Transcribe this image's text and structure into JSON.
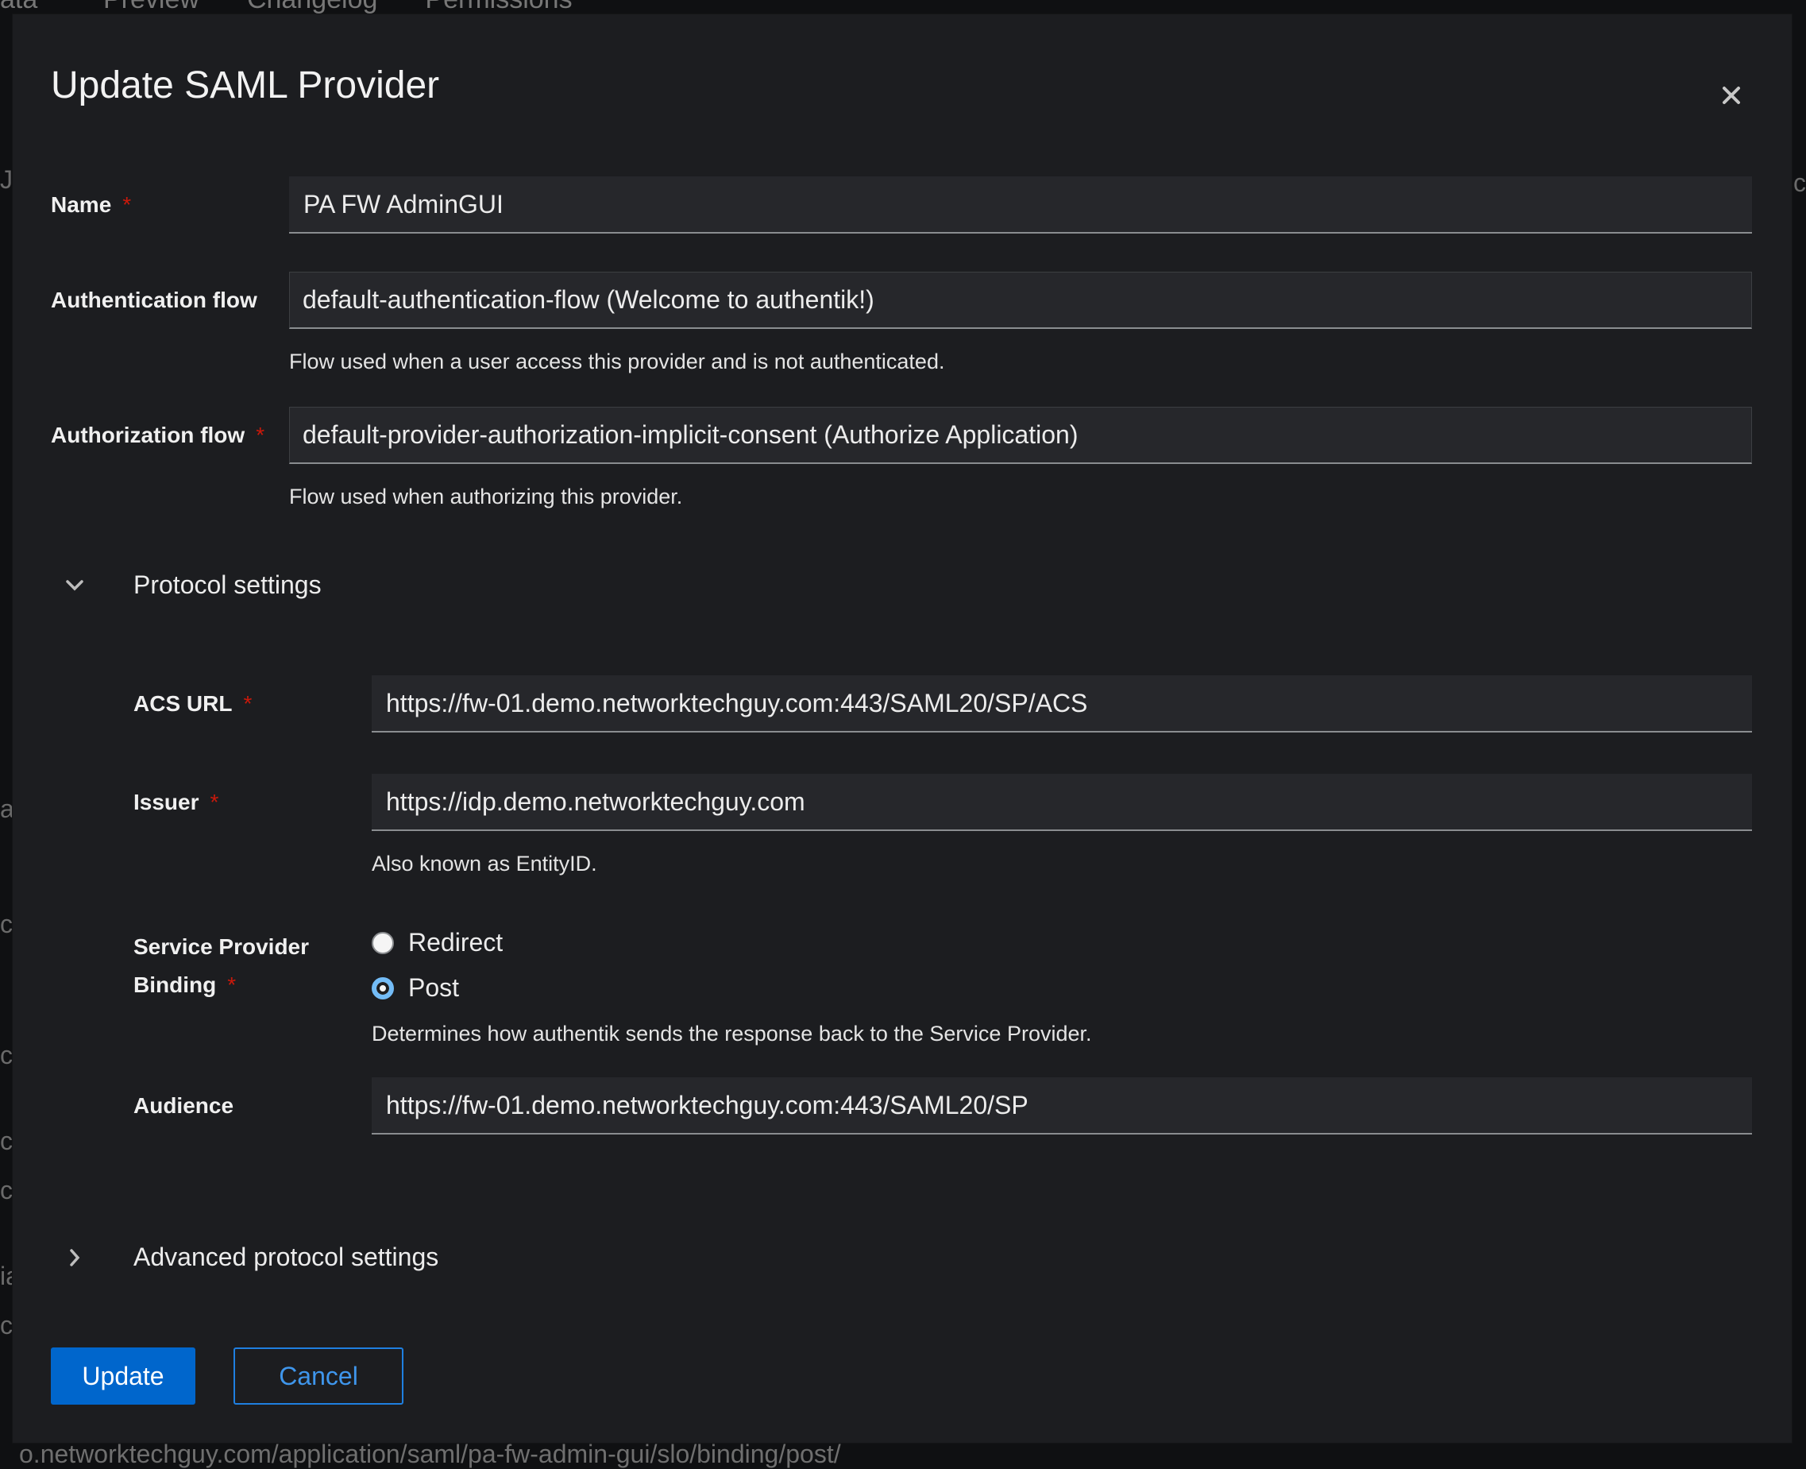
{
  "background": {
    "tabs": [
      "ata",
      "Preview",
      "Changelog",
      "Permissions"
    ],
    "url_fragment": "o.networktechguy.com/application/saml/pa-fw-admin-gui/slo/binding/post/",
    "left_edge": [
      "JI",
      "a",
      "c",
      "c",
      "ct",
      "c",
      "ia",
      "c"
    ],
    "right_edge": [
      "nc"
    ]
  },
  "modal": {
    "title": "Update SAML Provider",
    "close_icon": "close-icon"
  },
  "form": {
    "name": {
      "label": "Name",
      "required": "*",
      "value": "PA FW AdminGUI"
    },
    "authentication_flow": {
      "label": "Authentication flow",
      "value": "default-authentication-flow (Welcome to authentik!)",
      "help": "Flow used when a user access this provider and is not authenticated."
    },
    "authorization_flow": {
      "label": "Authorization flow",
      "required": "*",
      "value": "default-provider-authorization-implicit-consent (Authorize Application)",
      "help": "Flow used when authorizing this provider."
    },
    "protocol_settings": {
      "label": "Protocol settings",
      "expanded": true,
      "acs_url": {
        "label": "ACS URL",
        "required": "*",
        "value": "https://fw-01.demo.networktechguy.com:443/SAML20/SP/ACS"
      },
      "issuer": {
        "label": "Issuer",
        "required": "*",
        "value": "https://idp.demo.networktechguy.com",
        "help": "Also known as EntityID."
      },
      "sp_binding": {
        "label_line1": "Service Provider",
        "label_line2": "Binding",
        "required": "*",
        "options": [
          {
            "label": "Redirect",
            "checked": false
          },
          {
            "label": "Post",
            "checked": true
          }
        ],
        "help": "Determines how authentik sends the response back to the Service Provider."
      },
      "audience": {
        "label": "Audience",
        "value": "https://fw-01.demo.networktechguy.com:443/SAML20/SP"
      }
    },
    "advanced_protocol_settings": {
      "label": "Advanced protocol settings",
      "expanded": false
    }
  },
  "actions": {
    "update_label": "Update",
    "cancel_label": "Cancel"
  },
  "colors": {
    "primary": "#0066cc",
    "required": "#c9190b",
    "radio_checked": "#73bcf7",
    "modal_bg": "#1c1d20",
    "field_bg": "#26272b"
  }
}
